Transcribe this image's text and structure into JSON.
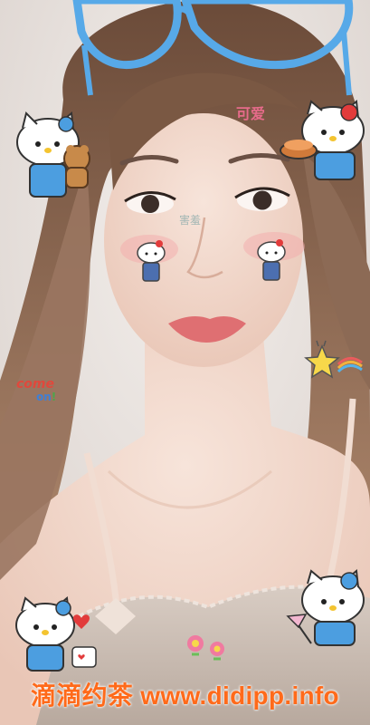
{
  "scene": {
    "description_tags": [
      "selfie",
      "hello-kitty-stickers",
      "beauty-filter"
    ],
    "stickers": {
      "forehead_text": "可爱",
      "cheek_text": "害羞",
      "come_text": "come",
      "on_text": "on",
      "on_mark": "!"
    },
    "watermark": "滴滴约茶 www.didipp.info"
  },
  "colors": {
    "background": "#e9e2df",
    "hair": "#8a6a52",
    "skin": "#f2d6c8",
    "glasses": "#57a9e8",
    "top": "#cdbfb5",
    "watermark": "#ff6a1a"
  }
}
